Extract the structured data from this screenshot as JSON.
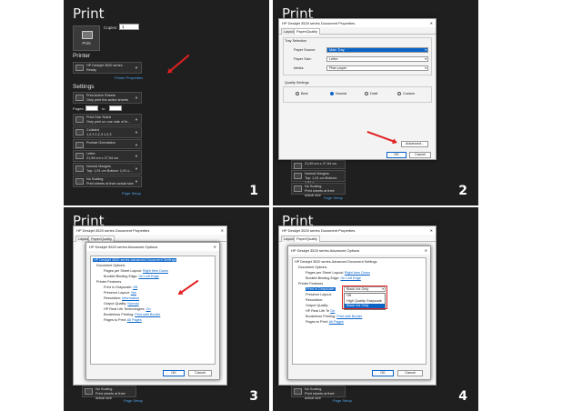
{
  "shared": {
    "print_title": "Print",
    "print_button": "Print",
    "copies_label": "Copies:",
    "copies_value": "1",
    "printer_heading": "Printer",
    "printer_name": "HP Deskjet 3520 series",
    "printer_status": "Ready",
    "printer_properties_link": "Printer Properties",
    "settings_heading": "Settings",
    "pages_label": "Pages:",
    "pages_to": "to",
    "page_setup_link": "Page Setup",
    "no_scaling": "No Scaling",
    "no_scaling_sub": "Print sheets at their actual size",
    "props_title": "HP Deskjet 3520 series Document Properties",
    "adv_title": "HP Deskjet 3520 series Advanced Options",
    "ok": "OK",
    "cancel": "Cancel",
    "tab_layout": "Layout",
    "tab_paper": "Paper/Quality"
  },
  "panel1": {
    "number": "1",
    "settings_items": [
      {
        "title": "Print Active Sheets",
        "sub": "Only print the active sheets"
      },
      {
        "title": "Print One Sided",
        "sub": "Only print on one side of th..."
      },
      {
        "title": "Collated",
        "sub": "1,2,3   1,2,3   1,2,3"
      },
      {
        "title": "Portrait Orientation",
        "sub": ""
      },
      {
        "title": "Letter",
        "sub": "21,59 cm x 27,94 cm"
      },
      {
        "title": "Normal Margins",
        "sub": "Top: 1,91 cm Bottom: 1,91 c..."
      }
    ]
  },
  "panel2": {
    "number": "2",
    "tray_selection": "Tray Selection",
    "paper_source_label": "Paper Source:",
    "paper_source_value": "Main Tray",
    "paper_size_label": "Paper Size:",
    "paper_size_value": "Letter",
    "media_label": "Media:",
    "media_value": "Plain paper",
    "quality_settings": "Quality Settings",
    "quality_options": [
      "Best",
      "Normal",
      "Draft",
      "Custom"
    ],
    "quality_selected": "Normal",
    "advanced_button": "Advanced...",
    "bg_letter_size": "21,59 cm x 27,94 cm",
    "bg_margins": "Normal Margins",
    "bg_margins_sub": "Top: 1,91 cm Bottom: 1,91 c..."
  },
  "panel3": {
    "number": "3",
    "tree_root": "HP Deskjet 3520 series Advanced Document Settings",
    "document_options": "Document Options",
    "pages_per_sheet_label": "Pages per Sheet Layout:",
    "pages_per_sheet_value": "Right then Down",
    "booklet_label": "Booklet Binding Edge:",
    "booklet_value": "On Left Edge",
    "printer_features": "Printer Features",
    "grayscale_label": "Print in Grayscale:",
    "grayscale_value": "Off",
    "preserve_label": "Preserve Layout:",
    "preserve_value": "Yes",
    "resolution_label": "Resolution:",
    "resolution_value": "Information",
    "output_label": "Output Quality:",
    "output_value": "Normal",
    "reallife_label": "HP Real Life Technologies:",
    "reallife_value": "On",
    "borderless_label": "Borderless Printing:",
    "borderless_value": "Print with Border",
    "pages_to_print_label": "Pages to Print:",
    "pages_to_print_value": "All Pages"
  },
  "panel4": {
    "number": "4",
    "grayscale_label": "Print in Grayscale:",
    "dropdown_value": "Black Ink Only",
    "dropdown_options": [
      "Off",
      "High Quality Grayscale",
      "Black Ink Only"
    ],
    "dropdown_selected": "Black Ink Only",
    "preserve_label": "Preserve Layout:",
    "resolution_label": "Resolution:",
    "output_label": "Output Quality:",
    "reallife_label": "HP Real Life Te",
    "reallife_value": "On",
    "borderless_label": "Borderless Printing:",
    "borderless_value": "Print with Border",
    "pages_to_print_label": "Pages to Print:",
    "pages_to_print_value": "All Pages"
  }
}
